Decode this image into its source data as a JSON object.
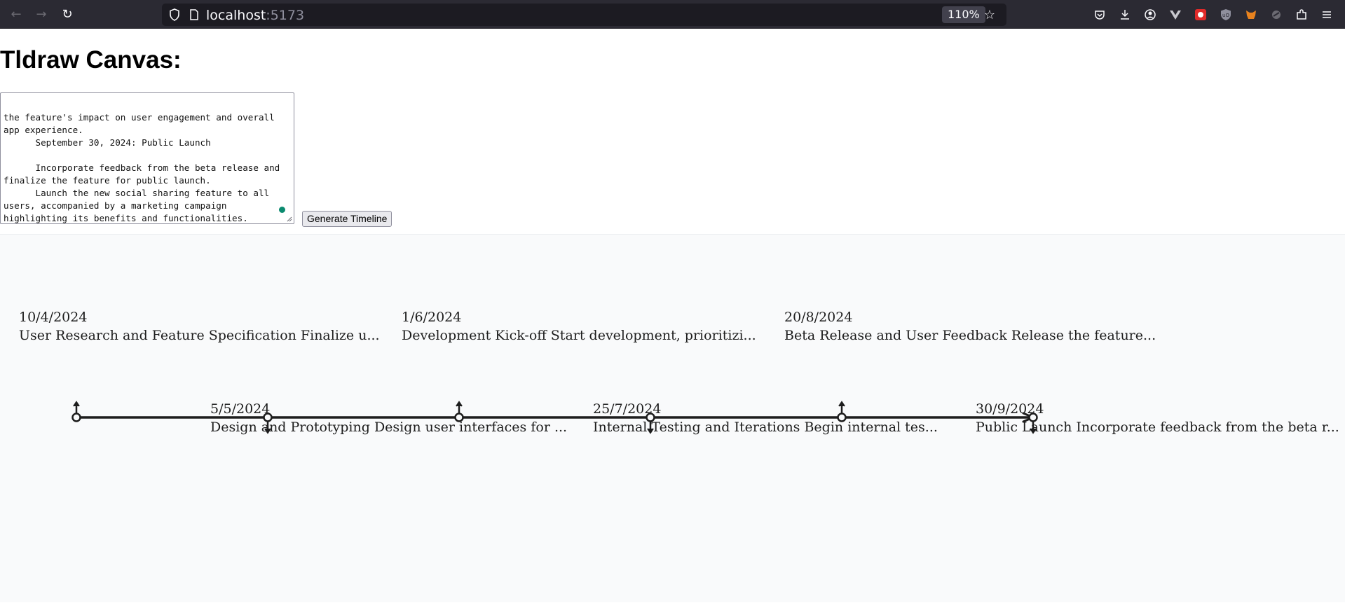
{
  "browser": {
    "url_host": "localhost",
    "url_port": ":5173",
    "zoom": "110%"
  },
  "page": {
    "title": "Tldraw Canvas:",
    "editor_text": "the feature's impact on user engagement and overall\napp experience.\n      September 30, 2024: Public Launch\n\n      Incorporate feedback from the beta release and\nfinalize the feature for public launch.\n      Launch the new social sharing feature to all\nusers, accompanied by a marketing campaign\nhighlighting its benefits and functionalities.",
    "generate_button": "Generate Timeline"
  },
  "timeline": {
    "events": [
      {
        "date": "10/4/2024",
        "label": "User Research and Feature Specification Finalize u...",
        "side": "above"
      },
      {
        "date": "5/5/2024",
        "label": "Design and Prototyping Design user interfaces for ...",
        "side": "below"
      },
      {
        "date": "1/6/2024",
        "label": "Development Kick-off Start development, prioritizi...",
        "side": "above"
      },
      {
        "date": "25/7/2024",
        "label": "Internal Testing and Iterations Begin internal tes...",
        "side": "below"
      },
      {
        "date": "20/8/2024",
        "label": "Beta Release and User Feedback Release the feature...",
        "side": "above"
      },
      {
        "date": "30/9/2024",
        "label": "Public Launch Incorporate feedback from the beta r...",
        "side": "below"
      }
    ]
  }
}
